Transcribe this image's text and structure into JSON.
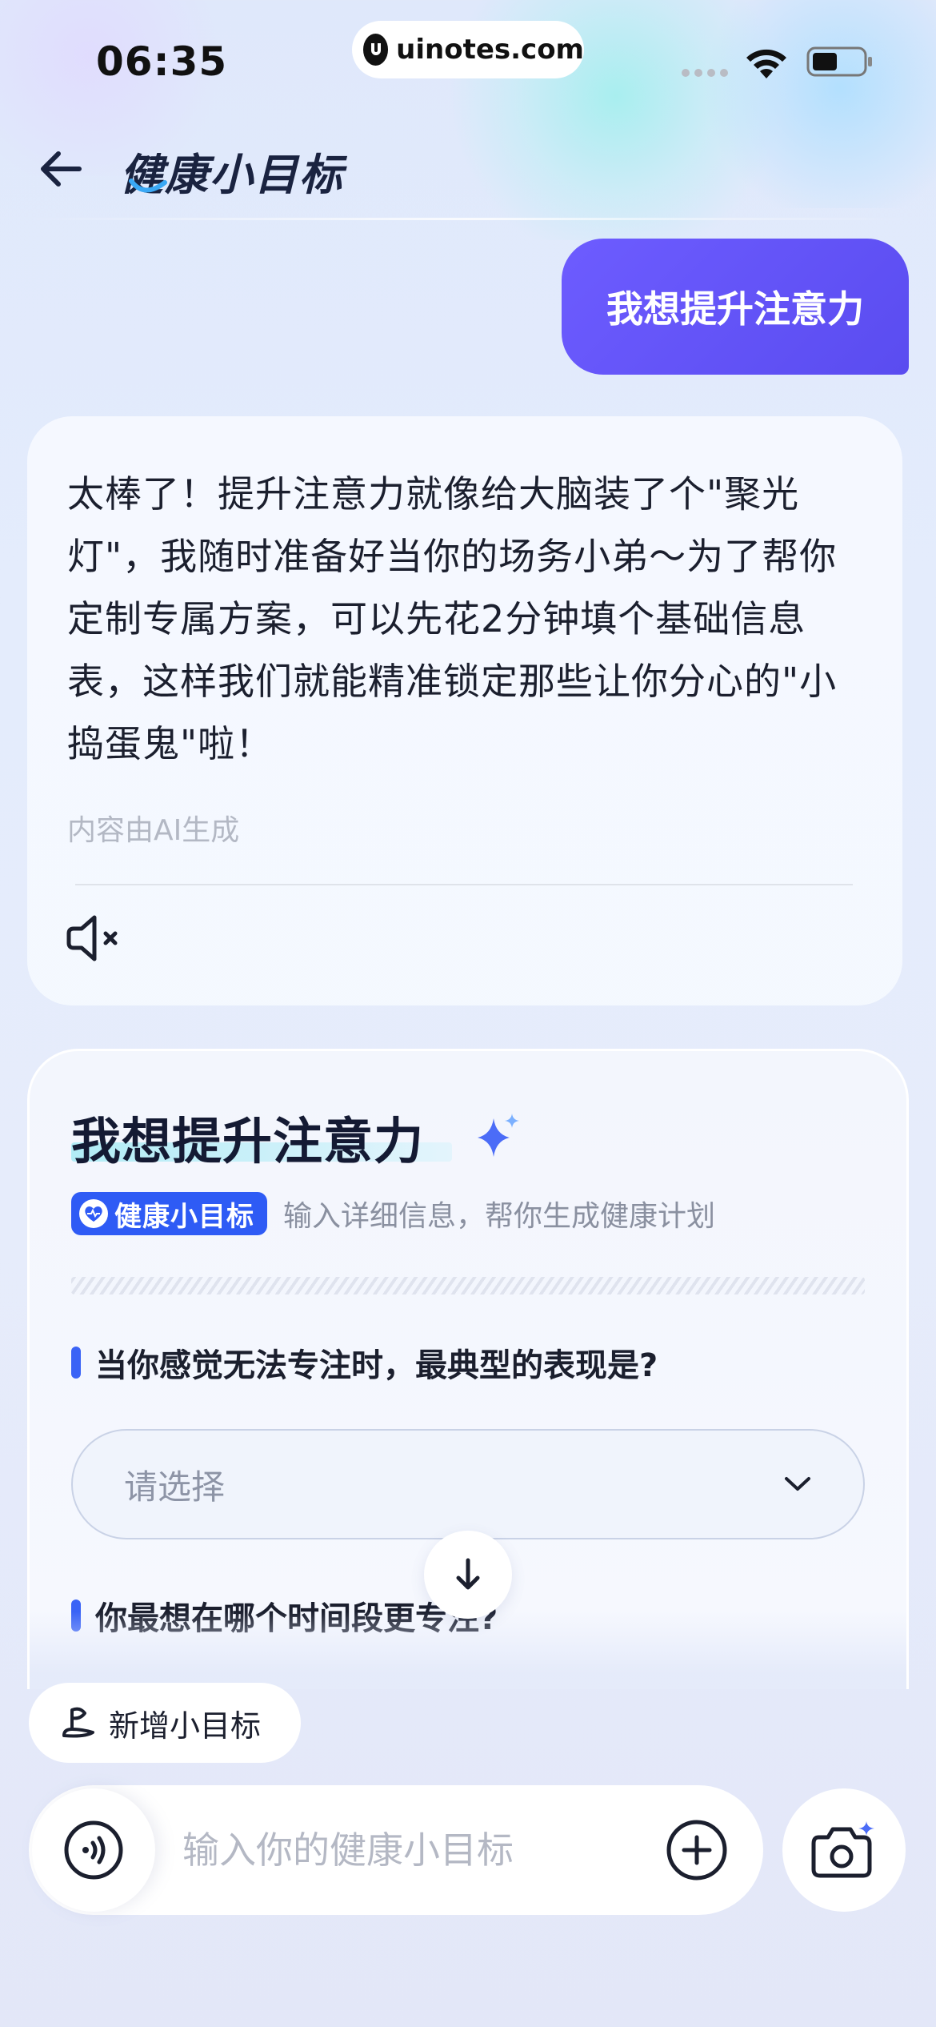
{
  "status_bar": {
    "time": "06:35",
    "url": "uinotes.com",
    "wifi_icon": "wifi-icon",
    "battery_icon": "battery-icon"
  },
  "header": {
    "title": "健康小目标",
    "back_icon": "arrow-left-icon"
  },
  "chat": {
    "user_message": "我想提升注意力",
    "bot_message": "太棒了！提升注意力就像给大脑装了个\"聚光灯\"，我随时准备好当你的场务小弟～为了帮你定制专属方案，可以先花2分钟填个基础信息表，这样我们就能精准锁定那些让你分心的\"小捣蛋鬼\"啦！",
    "ai_note": "内容由AI生成",
    "mute_icon": "speaker-muted-icon"
  },
  "form": {
    "title": "我想提升注意力",
    "tag": "健康小目标",
    "tag_desc": "输入详细信息，帮你生成健康计划",
    "question_1": "当你感觉无法专注时，最典型的表现是?",
    "select_placeholder": "请选择",
    "question_2": "你最想在哪个时间段更专注?"
  },
  "bottom": {
    "new_goal_label": "新增小目标",
    "input_placeholder": "输入你的健康小目标",
    "voice_icon": "voice-wave-icon",
    "plus_icon": "plus-circle-icon",
    "camera_icon": "camera-sparkle-icon"
  },
  "colors": {
    "accent": "#5a4cf0",
    "tag_blue": "#2e5bf5",
    "text_dark": "#1b1f2e"
  }
}
